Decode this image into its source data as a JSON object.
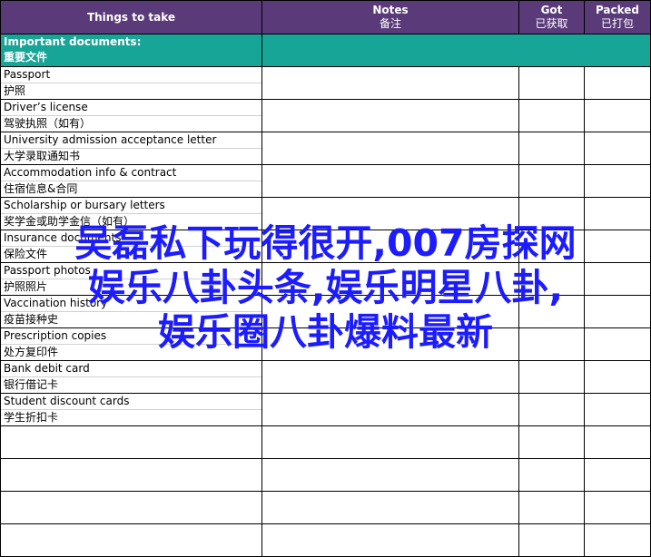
{
  "headers": {
    "things": "Things to take",
    "notes_en": "Notes",
    "notes_zh": "备注",
    "got_en": "Got",
    "got_zh": "已获取",
    "packed_en": "Packed",
    "packed_zh": "已打包"
  },
  "category": {
    "en": "Important documents:",
    "zh": "重要文件"
  },
  "items": [
    {
      "en": "Passport",
      "zh": "护照"
    },
    {
      "en": "Driver’s license",
      "zh": "驾驶执照（如有）"
    },
    {
      "en": "University admission acceptance letter",
      "zh": "大学录取通知书"
    },
    {
      "en": "Accommodation info & contract",
      "zh": "住宿信息&合同"
    },
    {
      "en": "Scholarship or bursary letters",
      "zh": "奖学金或助学金信（如有）"
    },
    {
      "en": "Insurance documents",
      "zh": "保险文件"
    },
    {
      "en": "Passport photos",
      "zh": "护照照片"
    },
    {
      "en": "Vaccination history",
      "zh": "疫苗接种史"
    },
    {
      "en": "Prescription copies",
      "zh": "处方复印件"
    },
    {
      "en": "Bank debit card",
      "zh": "银行借记卡"
    },
    {
      "en": "Student discount cards",
      "zh": "学生折扣卡"
    }
  ],
  "watermark": {
    "line1": "吴磊私下玩得很开,007房探网",
    "line2": "娱乐八卦头条,娱乐明星八卦,",
    "line3": "娱乐圈八卦爆料最新"
  }
}
